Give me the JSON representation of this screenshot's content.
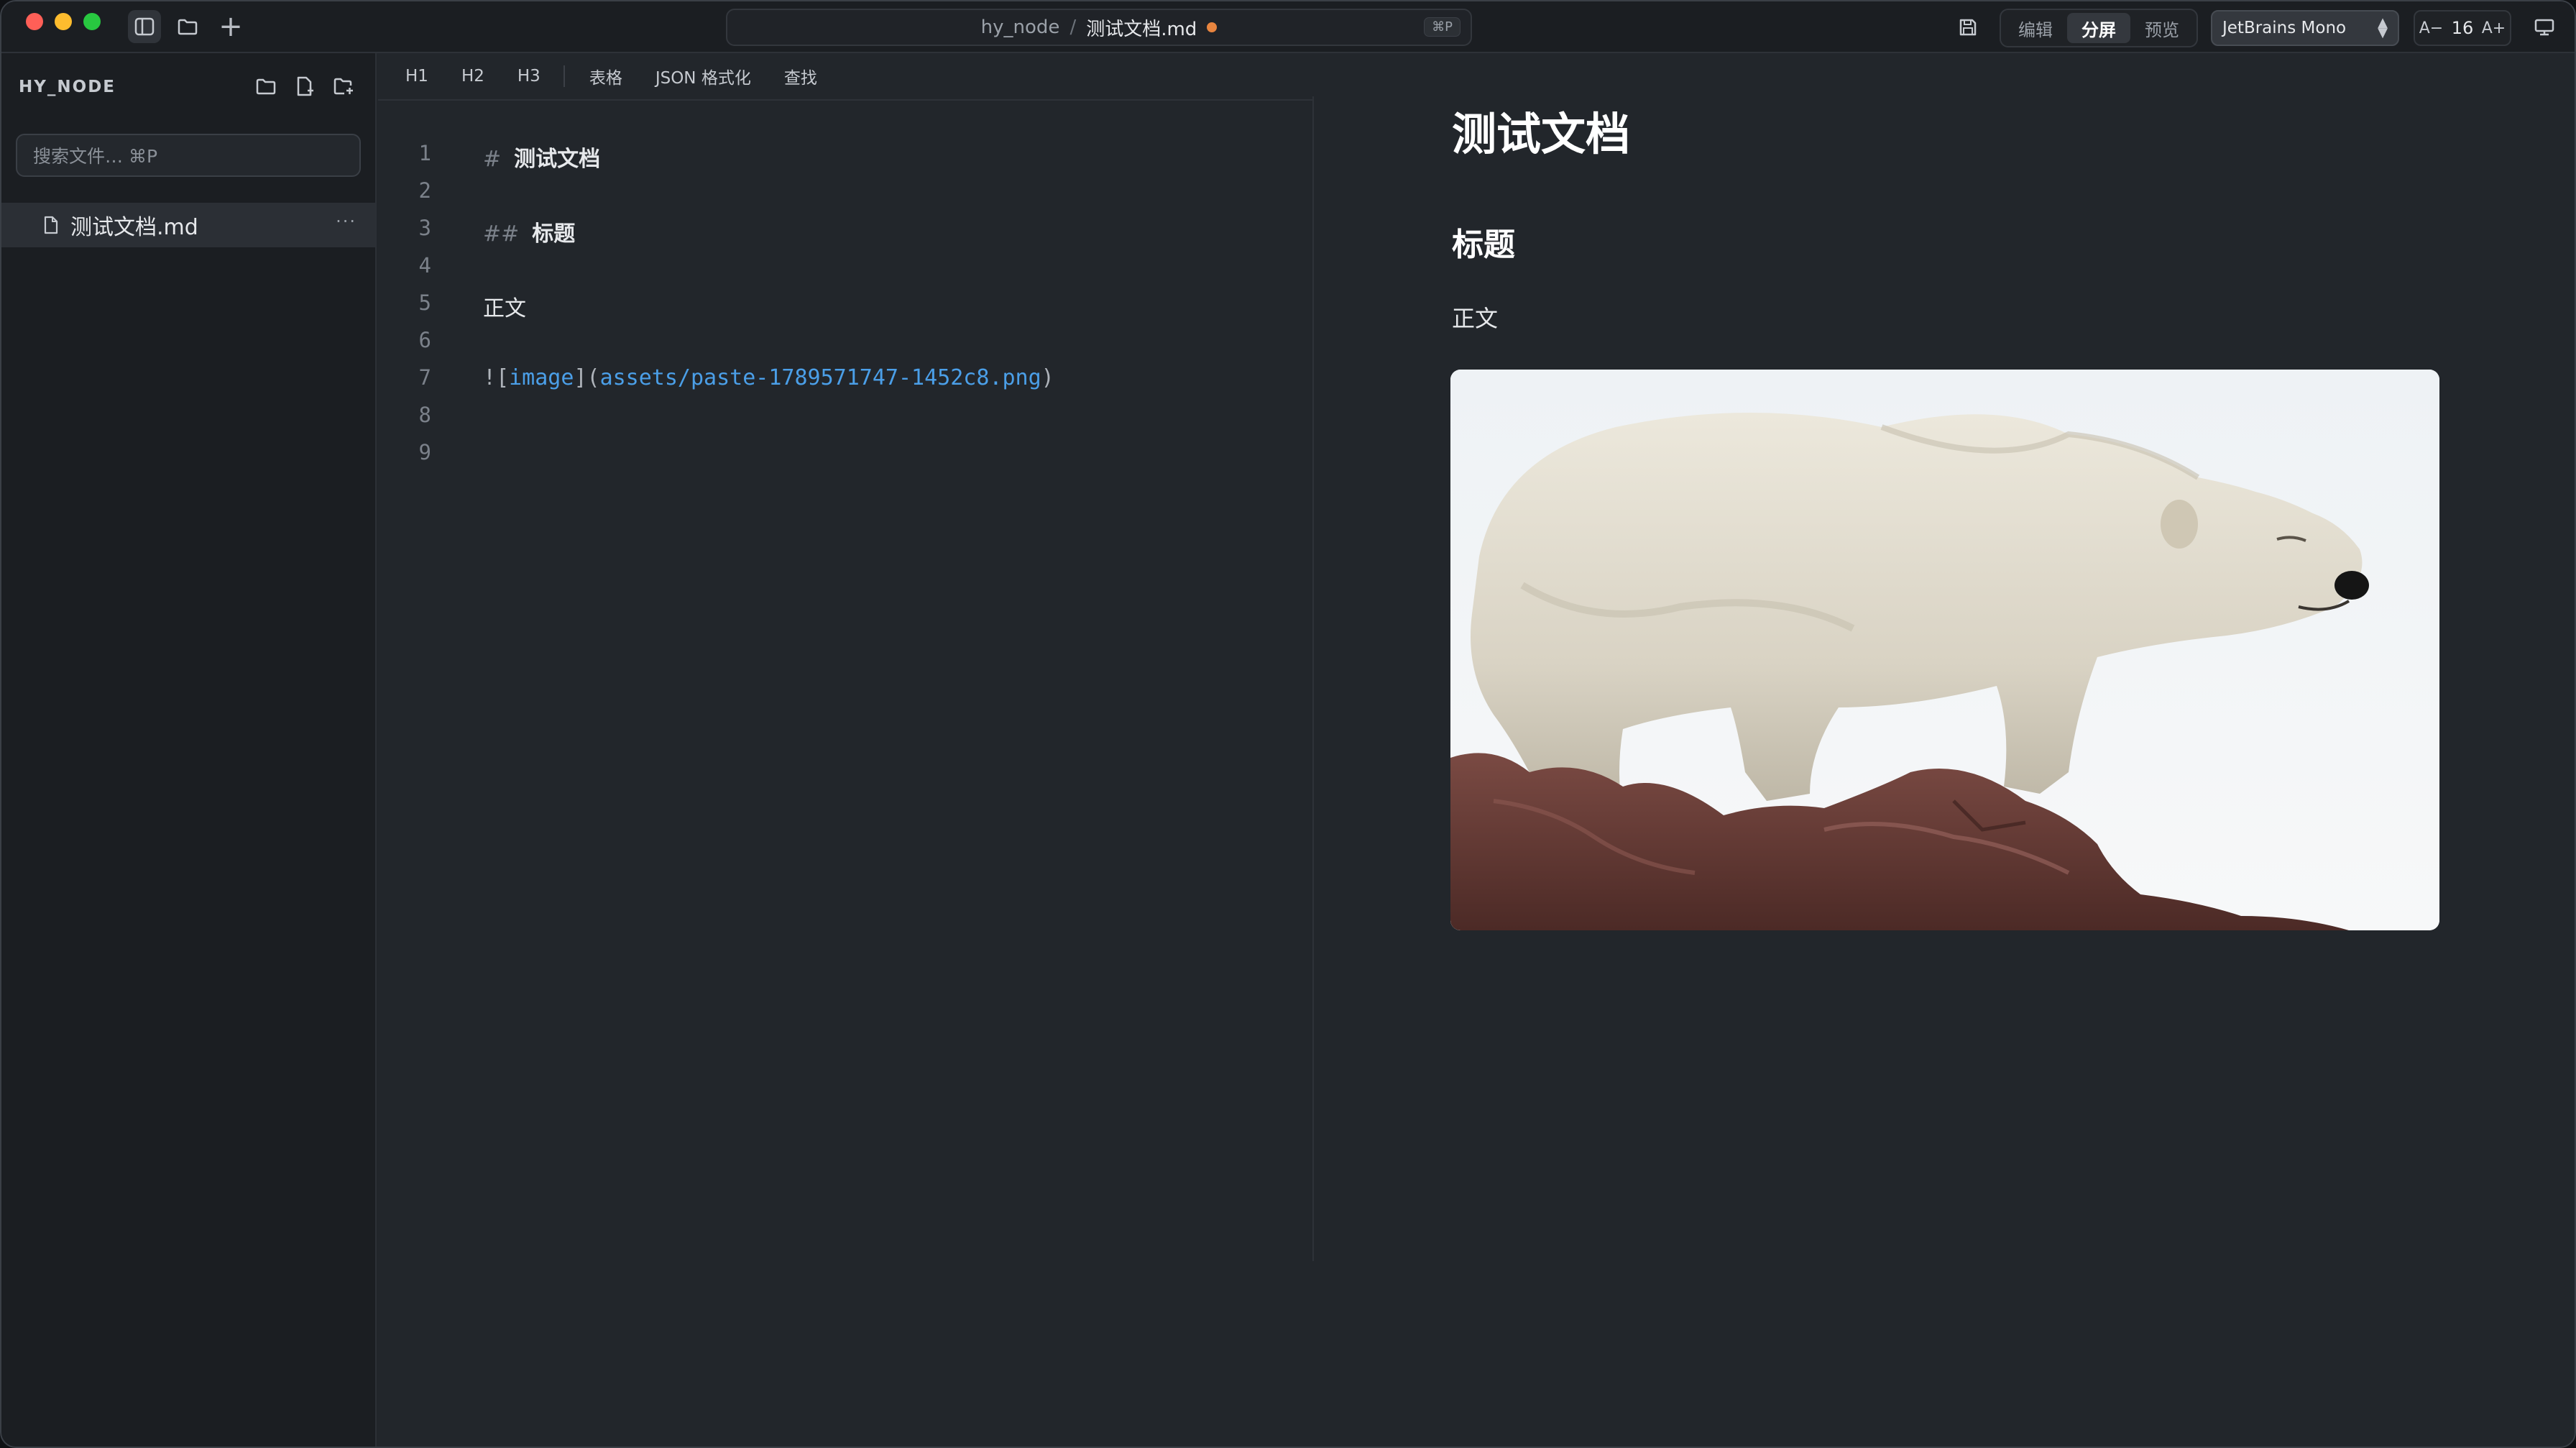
{
  "titlebar": {
    "project": "hy_node",
    "separator": "/",
    "filename": "测试文档.md",
    "shortcut": "⌘P",
    "modes": [
      "编辑",
      "分屏",
      "预览"
    ],
    "active_mode": "分屏",
    "font": "JetBrains Mono",
    "font_size_decrease": "A−",
    "font_size": "16",
    "font_size_increase": "A+",
    "unsaved_dot_color": "#e8853f"
  },
  "sidebar": {
    "title": "HY_NODE",
    "search_placeholder": "搜索文件… ⌘P",
    "files": [
      {
        "name": "测试文档.md",
        "more": "···"
      }
    ]
  },
  "toolbar": {
    "h1": "H1",
    "h2": "H2",
    "h3": "H3",
    "table": "表格",
    "json_format": "JSON 格式化",
    "find": "查找"
  },
  "editor": {
    "line_numbers": [
      "1",
      "2",
      "3",
      "4",
      "5",
      "6",
      "7",
      "8",
      "9"
    ],
    "line1": {
      "mark": "#",
      "text": "测试文档"
    },
    "line3": {
      "mark": "##",
      "text": "标题"
    },
    "line5": {
      "text": "正文"
    },
    "line7": {
      "bang": "!",
      "lbracket": "[",
      "alt": "image",
      "rbracket": "]",
      "lparen": "(",
      "path": "assets/paste-1789571747-1452c8.png",
      "rparen": ")"
    }
  },
  "preview": {
    "h1": "测试文档",
    "h2": "标题",
    "paragraph": "正文",
    "image_subject": "polar bear standing on red rocks"
  }
}
